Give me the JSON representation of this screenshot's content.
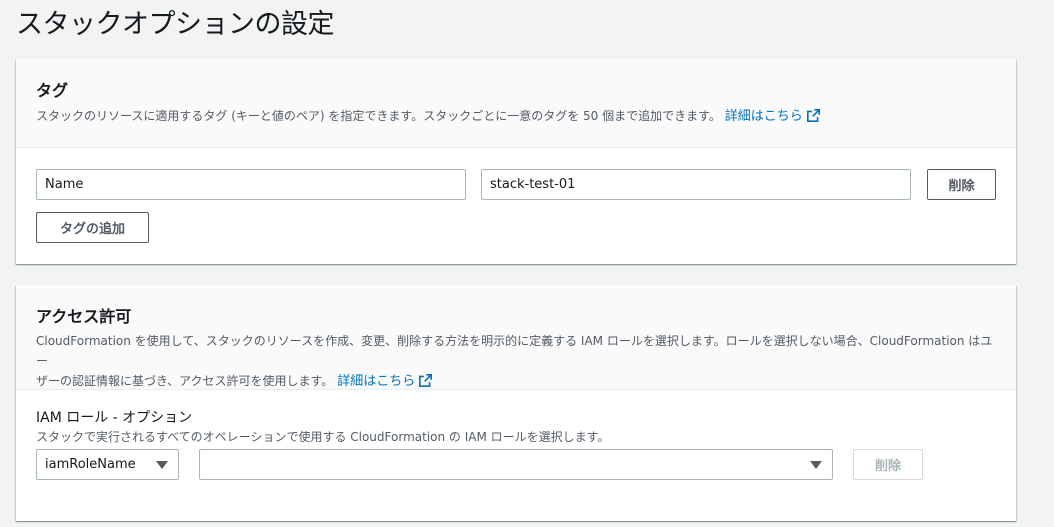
{
  "page": {
    "title": "スタックオプションの設定"
  },
  "tags": {
    "title": "タグ",
    "description": "スタックのリソースに適用するタグ (キーと値のペア) を指定できます。スタックごとに一意のタグを 50 個まで追加できます。",
    "learn_more": "詳細はこちら",
    "rows": [
      {
        "key": "Name",
        "value": "stack-test-01",
        "remove_label": "削除"
      }
    ],
    "add_label": "タグの追加"
  },
  "permissions": {
    "title": "アクセス許可",
    "description_line1": "CloudFormation を使用して、スタックのリソースを作成、変更、削除する方法を明示的に定義する IAM ロールを選択します。ロールを選択しない場合、CloudFormation はユー",
    "description_line2": "ザーの認証情報に基づき、アクセス許可を使用します。",
    "learn_more": "詳細はこちら",
    "iam_role": {
      "label": "IAM ロール - オプション",
      "description": "スタックで実行されるすべてのオペレーションで使用する CloudFormation の IAM ロールを選択します。",
      "type_selected": "iamRoleName",
      "role_selected": "",
      "remove_label": "削除"
    }
  },
  "colors": {
    "link": "#0073bb",
    "text": "#16191f",
    "muted": "#545b64",
    "background": "#f2f3f3"
  }
}
